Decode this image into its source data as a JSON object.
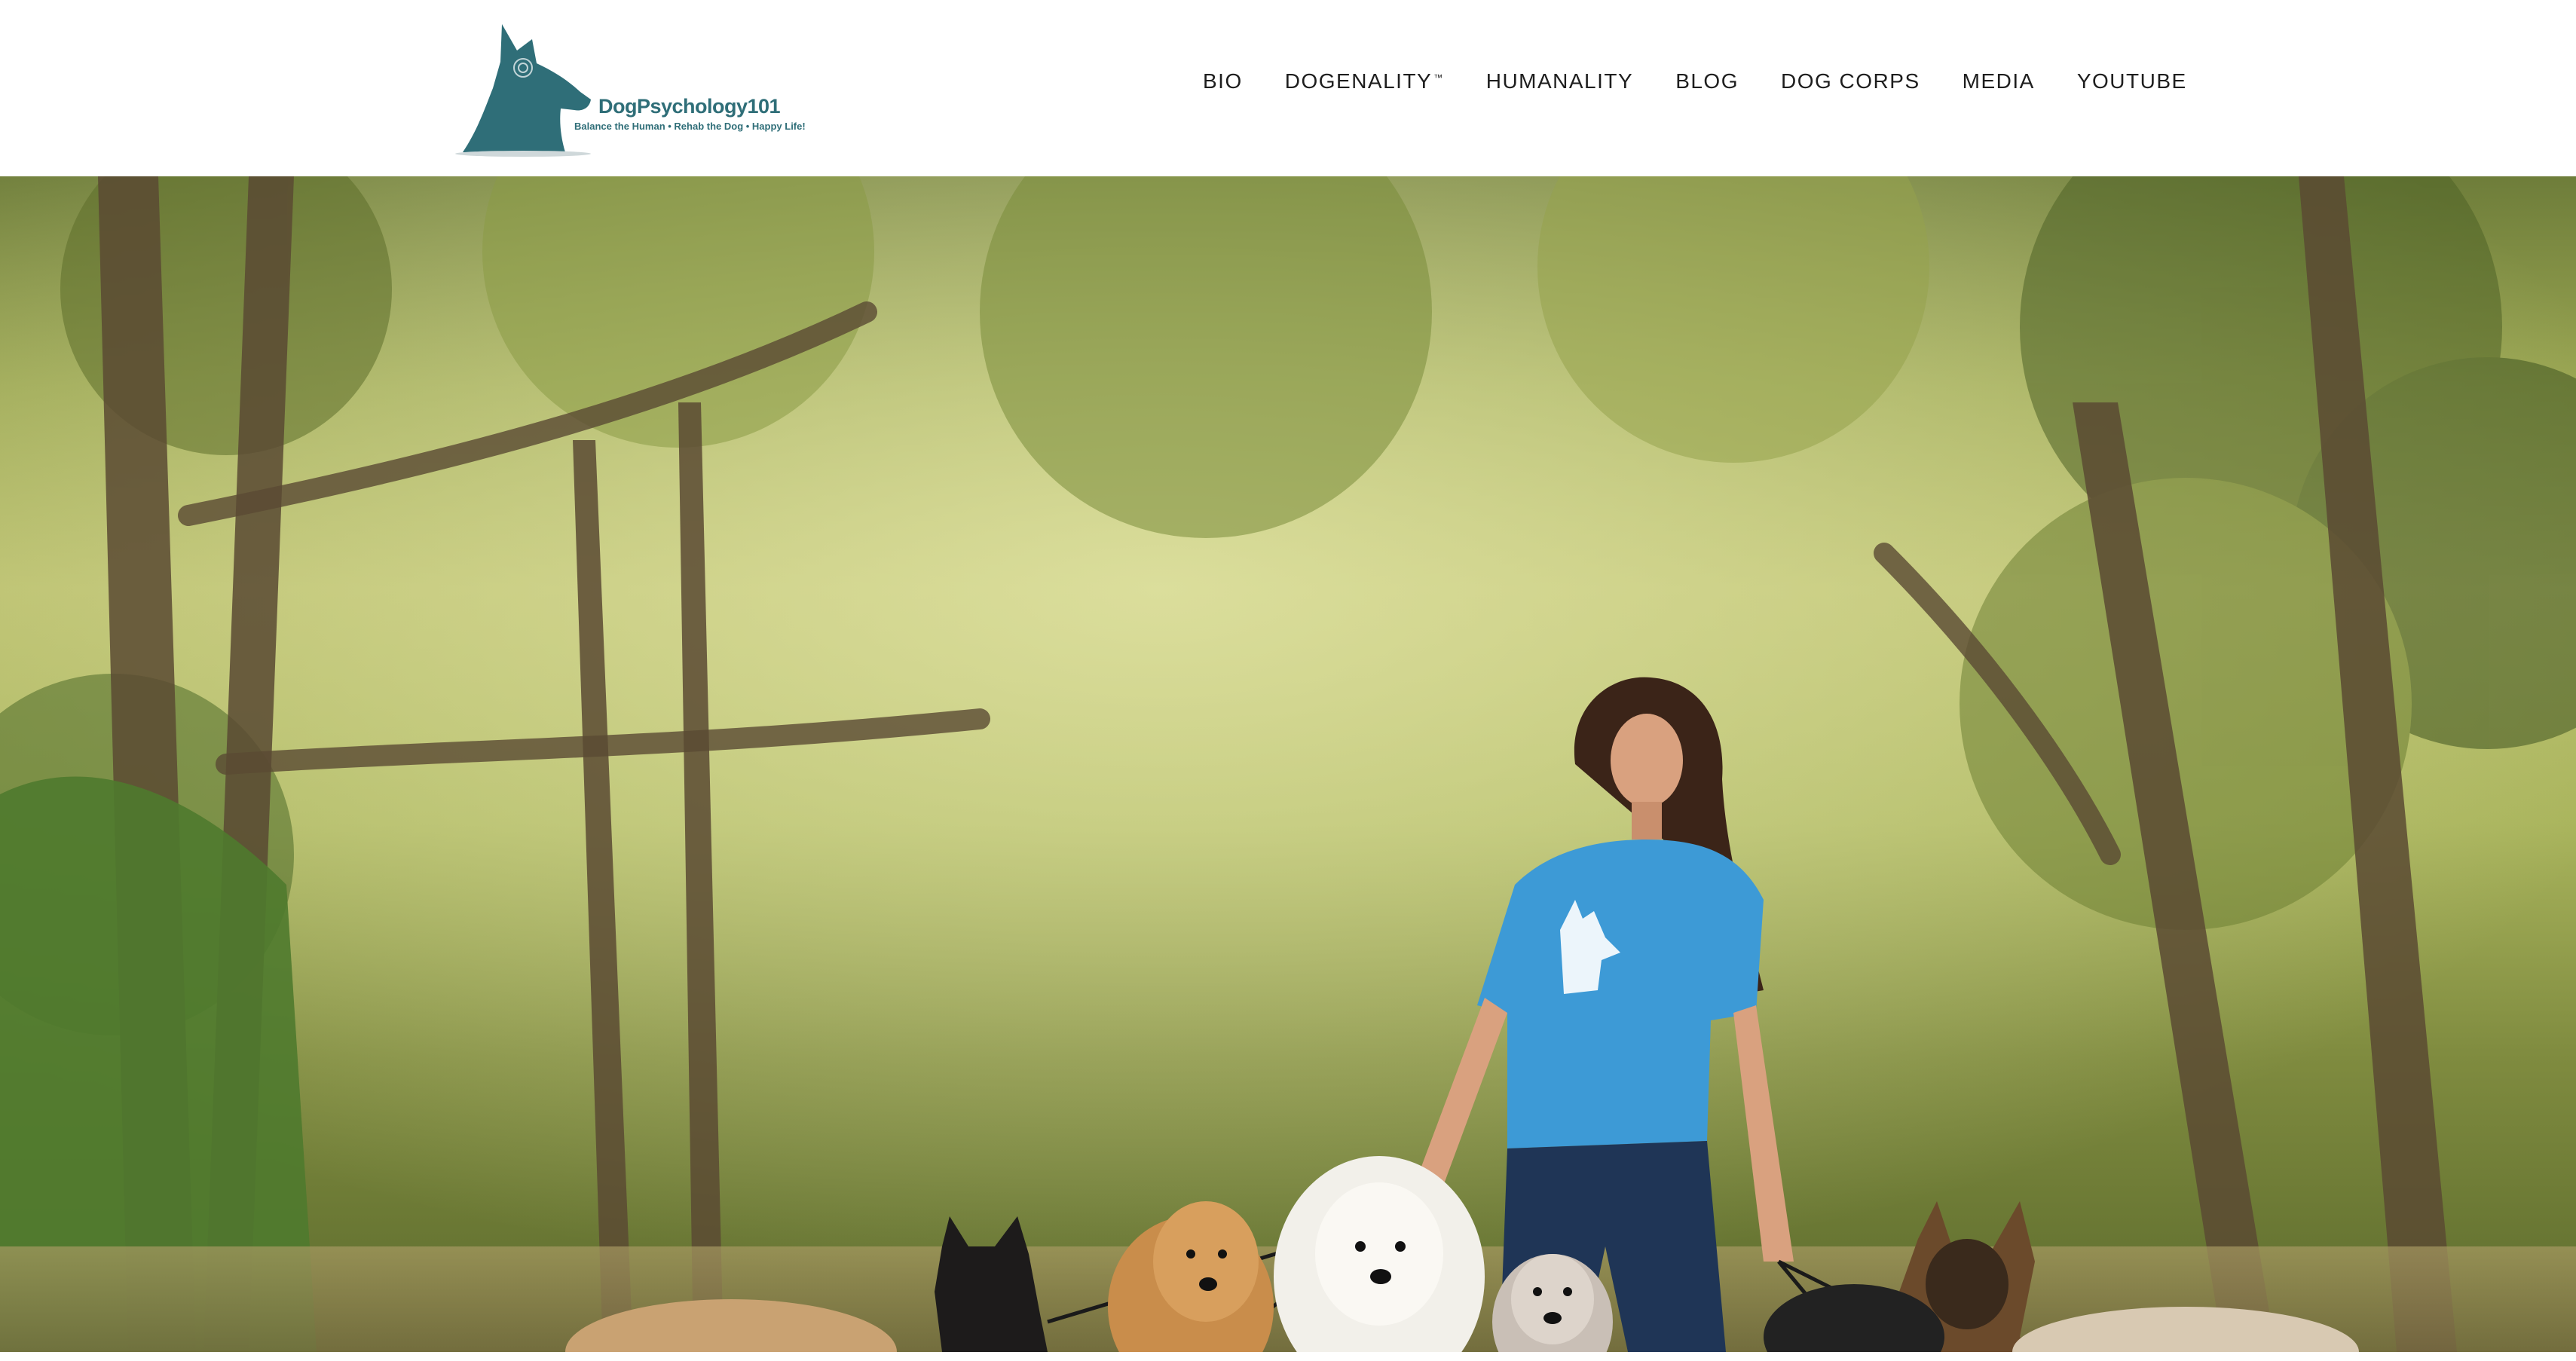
{
  "brand": {
    "name": "DogPsychology101",
    "tagline": "Balance the Human • Rehab the Dog • Happy Life!",
    "color": "#2f6e78",
    "logo_icon": "dog-head-logo-icon"
  },
  "nav": {
    "items": [
      {
        "label": "BIO"
      },
      {
        "label": "DOGENALITY",
        "suffix": "™"
      },
      {
        "label": "HUMANALITY"
      },
      {
        "label": "BLOG"
      },
      {
        "label": "DOG CORPS"
      },
      {
        "label": "MEDIA"
      },
      {
        "label": "YOUTUBE"
      }
    ]
  },
  "hero": {
    "image_subject": "woman-with-pack-of-dogs-in-forest",
    "colors": {
      "foliage": "#8c9a45",
      "shirt": "#3d9ad6",
      "jeans": "#1f3556"
    }
  }
}
